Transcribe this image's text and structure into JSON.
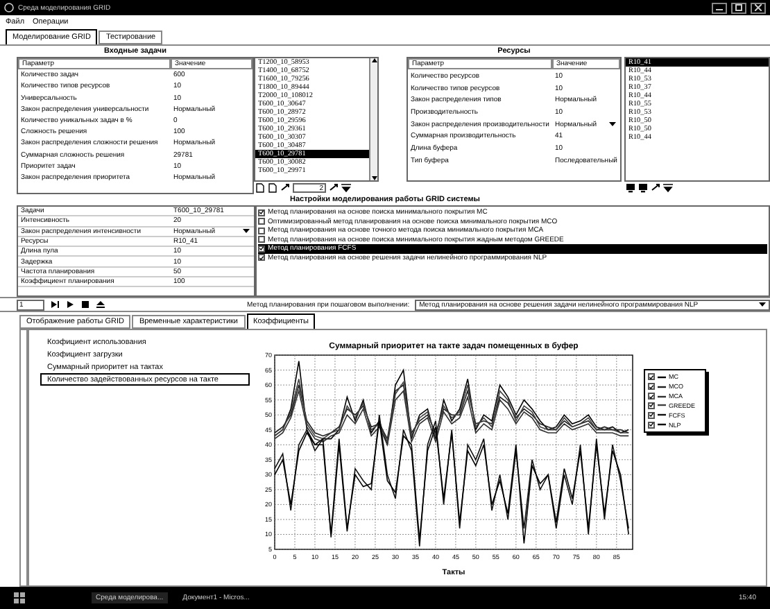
{
  "window": {
    "title": "Среда моделирования GRID"
  },
  "menu": [
    "Файл",
    "Операции"
  ],
  "main_tabs": [
    {
      "label": "Моделирование GRID",
      "selected": true
    },
    {
      "label": "Тестирование",
      "selected": false
    }
  ],
  "input_tasks": {
    "title": "Входные задачи",
    "columns": [
      "Параметр",
      "Значение"
    ],
    "rows": [
      [
        "Количество задач",
        "600"
      ],
      [
        "Количество типов ресурсов",
        "10"
      ],
      [
        "Универсальность",
        "10"
      ],
      [
        "Закон распределения универсальности",
        "Нормальный"
      ],
      [
        "Количество уникальных задач в %",
        "0"
      ],
      [
        "Сложность решения",
        "100"
      ],
      [
        "Закон распределения сложности решения",
        "Нормальный"
      ],
      [
        "Суммарная сложность решения",
        "29781"
      ],
      [
        "Приоритет задач",
        "10"
      ],
      [
        "Закон распределения приоритета",
        "Нормальный"
      ]
    ],
    "tasks": [
      {
        "label": "T1200_10_58953",
        "selected": false
      },
      {
        "label": "T1400_10_68752",
        "selected": false
      },
      {
        "label": "T1600_10_79256",
        "selected": false
      },
      {
        "label": "T1800_10_89444",
        "selected": false
      },
      {
        "label": "T2000_10_108012",
        "selected": false
      },
      {
        "label": "T600_10_30647",
        "selected": false
      },
      {
        "label": "T600_10_28972",
        "selected": false
      },
      {
        "label": "T600_10_29596",
        "selected": false
      },
      {
        "label": "T600_10_29361",
        "selected": false
      },
      {
        "label": "T600_10_30307",
        "selected": false
      },
      {
        "label": "T600_10_30487",
        "selected": false
      },
      {
        "label": "T600_10_29781",
        "selected": true
      },
      {
        "label": "T600_10_30082",
        "selected": false
      },
      {
        "label": "T600_10_29971",
        "selected": false
      }
    ],
    "spin_value": "2"
  },
  "resources": {
    "title": "Ресурсы",
    "columns": [
      "Параметр",
      "Значение"
    ],
    "rows": [
      {
        "label": "Количество ресурсов",
        "value": "10",
        "kind": "text"
      },
      {
        "label": "Количество типов ресурсов",
        "value": "10",
        "kind": "text"
      },
      {
        "label": "Закон распределения типов",
        "value": "Нормальный",
        "kind": "text"
      },
      {
        "label": "Производительность",
        "value": "10",
        "kind": "text"
      },
      {
        "label": "Закон распределения производительности",
        "value": "Нормальный",
        "kind": "dropdown"
      },
      {
        "label": "Суммарная производительность",
        "value": "41",
        "kind": "text"
      },
      {
        "label": "Длина буфера",
        "value": "10",
        "kind": "text"
      },
      {
        "label": "Тип буфера",
        "value": "Последовательный",
        "kind": "text"
      }
    ],
    "items": [
      {
        "label": "R10_41",
        "selected": true
      },
      {
        "label": "R10_44",
        "selected": false
      },
      {
        "label": "R10_53",
        "selected": false
      },
      {
        "label": "R10_37",
        "selected": false
      },
      {
        "label": "R10_44",
        "selected": false
      },
      {
        "label": "R10_55",
        "selected": false
      },
      {
        "label": "R10_53",
        "selected": false
      },
      {
        "label": "R10_50",
        "selected": false
      },
      {
        "label": "R10_50",
        "selected": false
      },
      {
        "label": "R10_44",
        "selected": false
      }
    ]
  },
  "settings": {
    "title": "Настройки моделирования работы GRID системы",
    "rows": [
      {
        "label": "Задачи",
        "value": "T600_10_29781",
        "kind": "text"
      },
      {
        "label": "Интенсивность",
        "value": "20",
        "kind": "text"
      },
      {
        "label": "Закон распределения интенсивности",
        "value": "Нормальный",
        "kind": "dropdown"
      },
      {
        "label": "Ресурсы",
        "value": "R10_41",
        "kind": "text"
      },
      {
        "label": "Длина пула",
        "value": "10",
        "kind": "text"
      },
      {
        "label": "Задержка",
        "value": "10",
        "kind": "text"
      },
      {
        "label": "Частота планирования",
        "value": "50",
        "kind": "text"
      },
      {
        "label": "Коэффициент планирования",
        "value": "100",
        "kind": "text"
      }
    ],
    "methods": [
      {
        "label": "Метод планирования на основе поиска минимального покрытия MC",
        "checked": true,
        "selected": false
      },
      {
        "label": "Оптимизированный метод планирования на основе поиска минимального покрытия MCO",
        "checked": false,
        "selected": false
      },
      {
        "label": "Метод планирования на основе точного метода поиска минимального покрытия MCA",
        "checked": false,
        "selected": false
      },
      {
        "label": "Метод планирования на основе поиска минимального покрытия жадным методом GREEDE",
        "checked": false,
        "selected": false
      },
      {
        "label": "Метод планирования FCFS",
        "checked": true,
        "selected": true
      },
      {
        "label": "Метод планирования на основе решения задачи нелинейного программирования NLP",
        "checked": true,
        "selected": false
      }
    ]
  },
  "step": {
    "value": "1",
    "method_label": "Метод планирования при пошаговом выполнении:",
    "method_value": "Метод планирования на основе решения задачи нелинейного программирования NLP"
  },
  "bottom_tabs": [
    {
      "label": "Отображение работы GRID",
      "selected": false
    },
    {
      "label": "Временные характеристики",
      "selected": false
    },
    {
      "label": "Коэффициенты",
      "selected": true
    }
  ],
  "coefficients": [
    {
      "label": "Коэфициент использования",
      "selected": false
    },
    {
      "label": "Коэфициент загрузки",
      "selected": false
    },
    {
      "label": "Суммарный приоритет на тактах",
      "selected": false
    },
    {
      "label": "Количество задействованных ресурсов на такте",
      "selected": true
    }
  ],
  "chart_data": {
    "type": "line",
    "title": "Суммарный приоритет на такте задач помещенных в буфер",
    "xlabel": "Такты",
    "x": [
      0,
      2,
      4,
      6,
      8,
      10,
      12,
      14,
      16,
      18,
      20,
      22,
      24,
      26,
      28,
      30,
      32,
      34,
      36,
      38,
      40,
      42,
      44,
      46,
      48,
      50,
      52,
      54,
      56,
      58,
      60,
      62,
      64,
      66,
      68,
      70,
      72,
      74,
      76,
      78,
      80,
      82,
      84,
      86,
      88
    ],
    "grid": true,
    "xlim": [
      0,
      89
    ],
    "ylim": [
      5,
      70
    ],
    "xticks": [
      0,
      5,
      10,
      15,
      20,
      25,
      30,
      35,
      40,
      45,
      50,
      55,
      60,
      65,
      70,
      75,
      80,
      85
    ],
    "yticks": [
      5,
      10,
      15,
      20,
      25,
      30,
      35,
      40,
      45,
      50,
      55,
      60,
      65,
      70
    ],
    "series": [
      {
        "name": "MC",
        "color": "#000000",
        "values": [
          43,
          45,
          52,
          68,
          45,
          40,
          42,
          42,
          45,
          56,
          48,
          55,
          44,
          48,
          40,
          60,
          65,
          42,
          50,
          52,
          42,
          55,
          48,
          52,
          62,
          45,
          50,
          48,
          60,
          56,
          50,
          55,
          52,
          48,
          45,
          46,
          50,
          47,
          48,
          50,
          46,
          45,
          46,
          44,
          45
        ]
      },
      {
        "name": "MCO",
        "color": "#202020",
        "values": [
          44,
          46,
          50,
          60,
          48,
          44,
          43,
          44,
          46,
          52,
          50,
          53,
          46,
          47,
          42,
          58,
          60,
          44,
          48,
          50,
          44,
          52,
          50,
          50,
          58,
          47,
          48,
          47,
          56,
          54,
          49,
          52,
          50,
          47,
          46,
          45,
          48,
          46,
          47,
          48,
          45,
          46,
          45,
          45,
          44
        ]
      },
      {
        "name": "MCA",
        "color": "#303030",
        "values": [
          42,
          44,
          49,
          58,
          46,
          42,
          41,
          43,
          44,
          50,
          47,
          52,
          43,
          46,
          40,
          55,
          58,
          41,
          47,
          49,
          41,
          51,
          47,
          49,
          56,
          44,
          47,
          45,
          55,
          52,
          47,
          51,
          49,
          45,
          44,
          44,
          47,
          45,
          46,
          47,
          44,
          44,
          44,
          43,
          43
        ]
      },
      {
        "name": "GREEDE",
        "color": "#404040",
        "values": [
          43,
          45,
          51,
          62,
          47,
          43,
          42,
          44,
          45,
          53,
          49,
          54,
          45,
          47,
          41,
          57,
          61,
          43,
          49,
          51,
          43,
          53,
          49,
          51,
          60,
          46,
          49,
          46,
          58,
          55,
          48,
          53,
          51,
          46,
          45,
          45,
          49,
          46,
          47,
          49,
          45,
          45,
          45,
          44,
          44
        ]
      },
      {
        "name": "FCFS",
        "color": "#101010",
        "values": [
          32,
          37,
          18,
          40,
          45,
          38,
          42,
          9,
          40,
          11,
          32,
          28,
          25,
          50,
          30,
          22,
          45,
          38,
          6,
          40,
          48,
          20,
          45,
          12,
          40,
          35,
          42,
          18,
          30,
          15,
          38,
          12,
          35,
          25,
          30,
          12,
          30,
          20,
          40,
          10,
          42,
          15,
          40,
          28,
          12
        ]
      },
      {
        "name": "NLP",
        "color": "#000000",
        "values": [
          30,
          35,
          20,
          38,
          44,
          40,
          40,
          10,
          42,
          12,
          30,
          26,
          27,
          48,
          28,
          24,
          43,
          40,
          8,
          38,
          46,
          22,
          44,
          14,
          38,
          33,
          40,
          20,
          28,
          17,
          40,
          7,
          33,
          27,
          30,
          14,
          32,
          22,
          38,
          12,
          40,
          17,
          38,
          30,
          10
        ]
      }
    ]
  },
  "legend": [
    {
      "checked": true
    },
    {
      "checked": true
    },
    {
      "checked": true
    },
    {
      "checked": true
    },
    {
      "checked": true
    },
    {
      "checked": true
    }
  ],
  "taskbar": {
    "items": [
      {
        "label": "Среда моделирова...",
        "selected": true
      },
      {
        "label": "Документ1 - Micros...",
        "selected": false
      }
    ],
    "clock": "15:40"
  }
}
